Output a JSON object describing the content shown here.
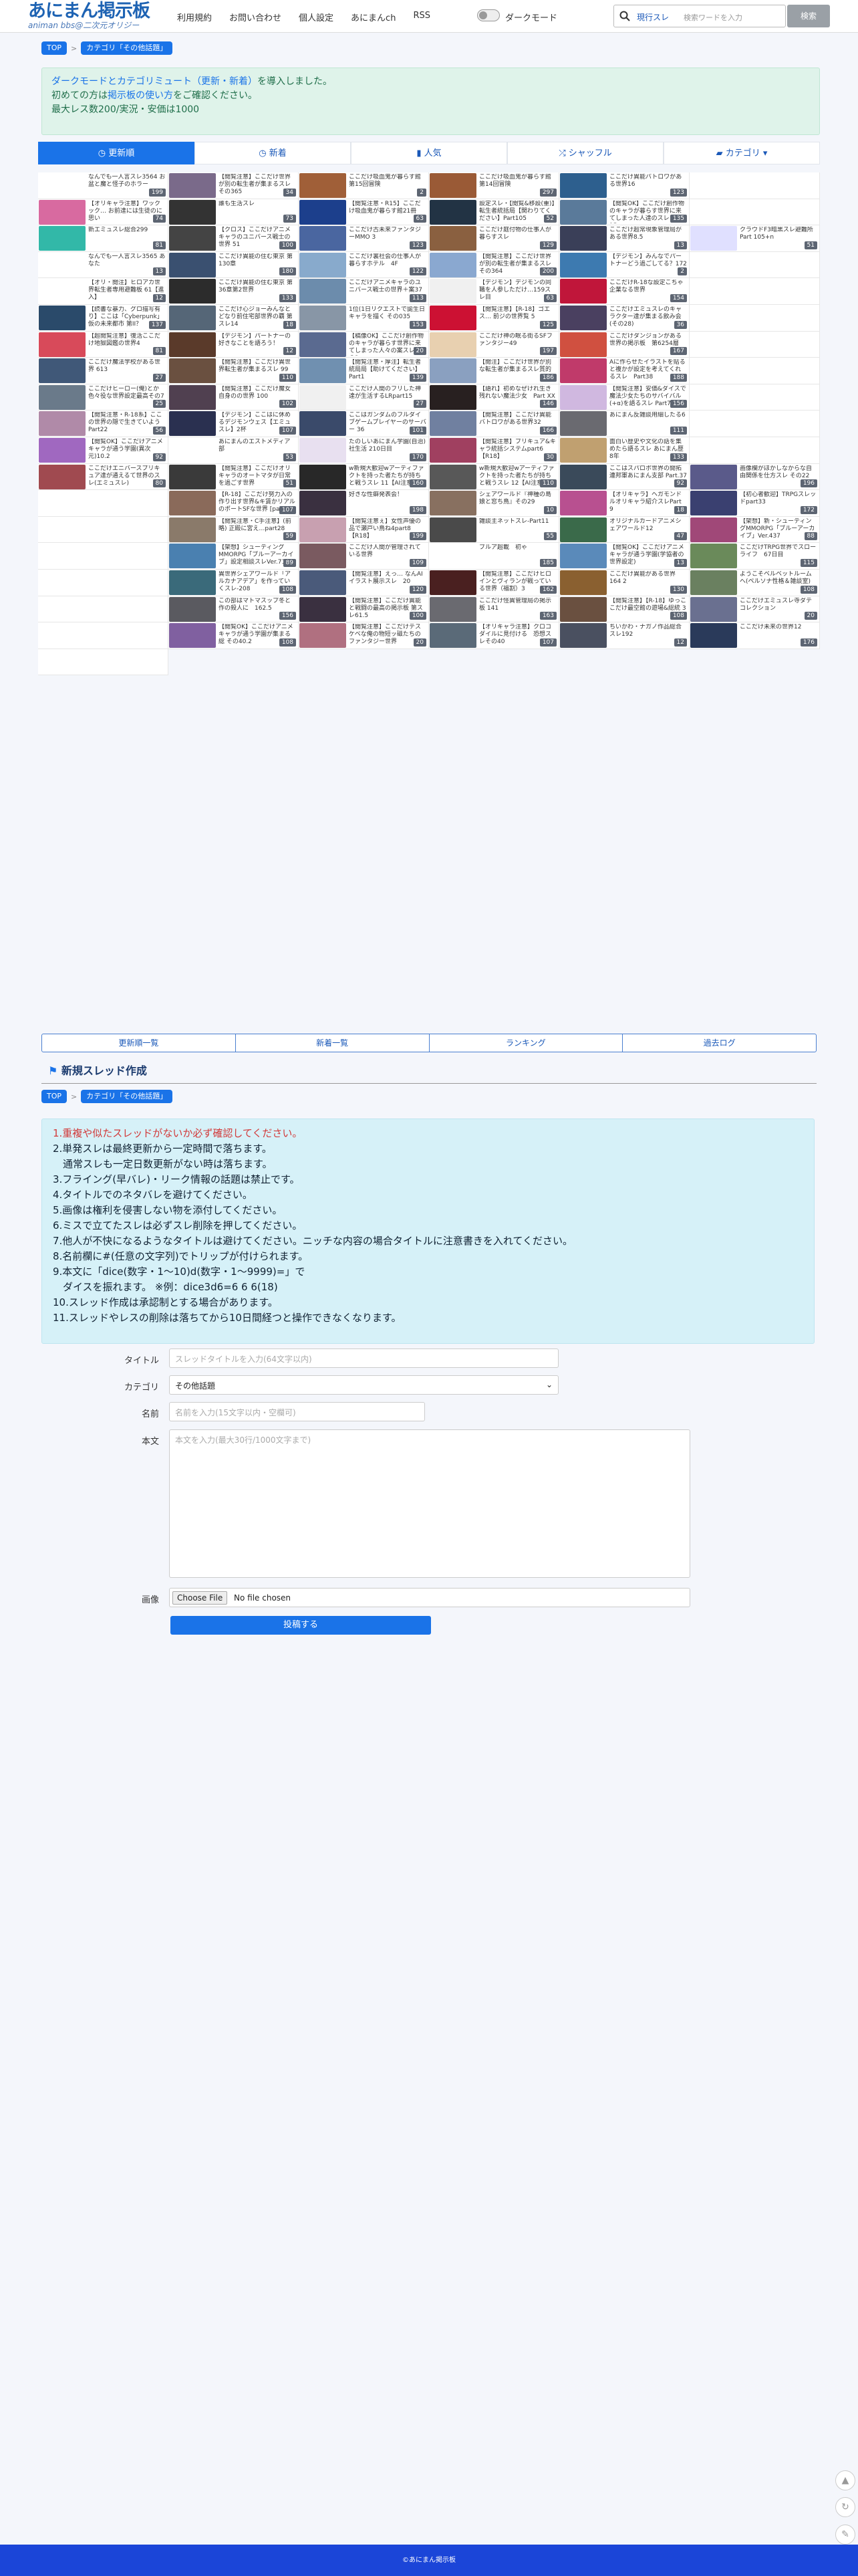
{
  "header": {
    "logo": "あにまん掲示板",
    "logo_sub": "animan bbs@二次元オリジー",
    "nav": [
      "利用規約",
      "お問い合わせ",
      "個人設定",
      "あにまんch",
      "RSS"
    ],
    "darkmode": "ダークモード",
    "search_select": "現行スレ",
    "search_placeholder": "検索ワードを入力",
    "search_button": "検索"
  },
  "breadcrumb": {
    "top": "TOP",
    "category": "カテゴリ「その他話題」"
  },
  "notice": {
    "line1_link": "ダークモードとカテゴリミュート（更新・新着）",
    "line1_rest": "を導入しました。",
    "line2_pre": "初めての方は",
    "line2_link": "掲示板の使い方",
    "line2_post": "をご確認ください。",
    "line3": "最大レス数200/実況・安価は1000"
  },
  "tabs": [
    "更新順",
    "新着",
    "人気",
    "シャッフル",
    "カテゴリ"
  ],
  "threads": [
    {
      "t": "なんでも一人言スレ3564 お盆と魔と怪子のホラー",
      "c": "199",
      "col": "#ffffff"
    },
    {
      "t": "【閲覧注意】ここだけ世界が別の転生者が集まるスレその365",
      "c": "34",
      "col": "#7a6a8a"
    },
    {
      "t": "ここだけ吸血鬼が暮らす館第15回冒険",
      "c": "2",
      "col": "#a05f38"
    },
    {
      "t": "ここだけ吸血鬼が暮らす館第14回冒険",
      "c": "297",
      "col": "#9a5a36"
    },
    {
      "t": "ここだけ異能バトロワがある世界16",
      "c": "123",
      "col": "#2d5f8e"
    },
    {
      "t": "",
      "c": "",
      "col": "#ffffff"
    },
    {
      "t": "【オリキャラ注意】ワックック… お前達には生徒のに思い",
      "c": "74",
      "col": "#d86aa0"
    },
    {
      "t": "誰も生活スレ",
      "c": "73",
      "col": "#333333"
    },
    {
      "t": "【閲覧注意・R15】ここだけ吸血鬼が暮らす館21冊",
      "c": "63",
      "col": "#1c3f8c"
    },
    {
      "t": "設定スレ・【閲覧&移設(重)】転生者統括局【関わりてください】Part105",
      "c": "52",
      "col": "#223344"
    },
    {
      "t": "【閲覧OK】ここだけ創作物のキャラが暮らす世界に来てしまった人達のスレ その15",
      "c": "135",
      "col": "#5a7a9a"
    },
    {
      "t": "",
      "c": "",
      "col": "#ffffff"
    },
    {
      "t": "新エミュスレ総合299",
      "c": "81",
      "col": "#32b8a8"
    },
    {
      "t": "【クロス】ここだけアニメキャラのユニバース戦士の世界 51",
      "c": "100",
      "col": "#444444"
    },
    {
      "t": "ここだけ古未来ファンタジーMMO 3",
      "c": "123",
      "col": "#4a66a0"
    },
    {
      "t": "ここだけ庭付物の仕事人が暮らすスレ",
      "c": "129",
      "col": "#8a6040"
    },
    {
      "t": "ここだけ超常現象管理局がある世界8.5",
      "c": "13",
      "col": "#3a3f58"
    },
    {
      "t": "クラウドF3暗黒スレ避難所Part 105+n",
      "c": "51",
      "col": "#e0e0ff"
    },
    {
      "t": "なんでも一人言スレ3565 あなた",
      "c": "13",
      "col": "#ffffff"
    },
    {
      "t": "ここだけ異能の住む東京 第130章",
      "c": "180",
      "col": "#3a5070"
    },
    {
      "t": "ここだけ裏社会の仕事人が暮らすホテル　4F",
      "c": "122",
      "col": "#88aacc"
    },
    {
      "t": "【閲覧注意】ここだけ世界が別の転生者が集まるスレその364",
      "c": "200",
      "col": "#8aa8d0"
    },
    {
      "t": "【デジモン】みんなでパートナーどう過ごしてる？172",
      "c": "2",
      "col": "#3d7ab0"
    },
    {
      "t": "",
      "c": "",
      "col": "#ffffff"
    },
    {
      "t": "【オリ・閲注】ヒロアカ世界転生者専用避難板 61【進入】",
      "c": "12",
      "col": "#ffffff"
    },
    {
      "t": "ここだけ異能の住む東京 第36章第2世界",
      "c": "133",
      "col": "#2c2c2c"
    },
    {
      "t": "ここだけアニメキャラのユニバース戦士の世界＋案37",
      "c": "113",
      "col": "#6c8cac"
    },
    {
      "t": "【デジモン】デジモンの同職を人参しただけ…159スレ目",
      "c": "63",
      "col": "#f0f0f0"
    },
    {
      "t": "ここだけR-18な設定こちゃ企業なる世界",
      "c": "154",
      "col": "#c0163a"
    },
    {
      "t": "",
      "c": "",
      "col": "#ffffff"
    },
    {
      "t": "【読書な暴力、グロ描写有り】ここは「Cyberpunk」仮の未来都市 第II？",
      "c": "137",
      "col": "#2a4a6a"
    },
    {
      "t": "ここだけ心ジョーみんなとどなり前住宅部世界の覇 第スレ14",
      "c": "18",
      "col": "#556677"
    },
    {
      "t": "1位(1日リクエストで誕生日キャラを描く その035",
      "c": "153",
      "col": "#8896a6"
    },
    {
      "t": "【閲覧注意】【R-18】ゴエス… 前ジの世界覧 5",
      "c": "125",
      "col": "#cc1133"
    },
    {
      "t": "ここだけエミュスレのキャラクター達が集まる飲み会(その28)",
      "c": "36",
      "col": "#4a4060"
    },
    {
      "t": "",
      "c": "",
      "col": "#ffffff"
    },
    {
      "t": "【超閲覧注意】復活ここだけ地獄図鑑の世界4",
      "c": "81",
      "col": "#d84a5a"
    },
    {
      "t": "【デジモン】パートナーの好きなことを語ろう！",
      "c": "12",
      "col": "#5a3a2a"
    },
    {
      "t": "【稿像OK】ここだけ創作物のキャラが暮らす世界に来てしまった人々の案スレ その3",
      "c": "20",
      "col": "#5a6a90"
    },
    {
      "t": "ここだけ神の眠る街るSFファンタジー49",
      "c": "197",
      "col": "#e8d0b0"
    },
    {
      "t": "ここだけダンジョンがある世界の掲示板　第6254層",
      "c": "167",
      "col": "#d05040"
    },
    {
      "t": "",
      "c": "",
      "col": "#ffffff"
    },
    {
      "t": "ここだけ魔法学校がある世界 613",
      "c": "27",
      "col": "#405878"
    },
    {
      "t": "【閲覧注意】ここだけ異世界転生者が集まるスレ 99",
      "c": "110",
      "col": "#6a5040"
    },
    {
      "t": "【閲覧注意・厚注】転生者統局局【助けてください】Part1",
      "c": "139",
      "col": "#7090b0"
    },
    {
      "t": "【閲注】ここだけ世界が別な転生者が集まるスレ質的",
      "c": "186",
      "col": "#8aa0c0"
    },
    {
      "t": "Aに作らせたイラストを貼ると複かが設定を考えてくれるスレ　Part38",
      "c": "188",
      "col": "#c03a6a"
    },
    {
      "t": "",
      "c": "",
      "col": "#ffffff"
    },
    {
      "t": "ここだけヒーロー(俺)とか色々役な世界設定最高その7",
      "c": "25",
      "col": "#6a7a8a"
    },
    {
      "t": "【閲覧注意】ここだけ魔女自身のの世界 100",
      "c": "102",
      "col": "#504050"
    },
    {
      "t": "ここだけ人間のフリした神達が生活するLRpart15",
      "c": "27",
      "col": "#f0f0f0"
    },
    {
      "t": "【語れ】初めなぜけれ生き残れない魔法少女　Part XX",
      "c": "146",
      "col": "#282020"
    },
    {
      "t": "【閲覧注意】安価&ダイスで魔法少女たちのサバイバル(+α)を語るスレ Part7",
      "c": "156",
      "col": "#d0b8e0"
    },
    {
      "t": "",
      "c": "",
      "col": "#ffffff"
    },
    {
      "t": "【閲覧注意・R-18系】ここの世界の隠で生きていようPart22",
      "c": "56",
      "col": "#b08aa8"
    },
    {
      "t": "【デジモン】ここはに休めるデジモンウェス【エミュスレ】2杯",
      "c": "107",
      "col": "#2a3050"
    },
    {
      "t": "ここはガンダムのフルダイブゲームプレイヤーのサーバー 36",
      "c": "101",
      "col": "#3a4a6a"
    },
    {
      "t": "【閲覧注意】ここだけ異能バトロワがある世界32",
      "c": "166",
      "col": "#7080a0"
    },
    {
      "t": "あにまん反雑談用細したる6",
      "c": "111",
      "col": "#6a6a70"
    },
    {
      "t": "",
      "c": "",
      "col": "#ffffff"
    },
    {
      "t": "【閲覧OK】ここだけアニメキャラが通う学園(異次元)10.2",
      "c": "92",
      "col": "#a068c0"
    },
    {
      "t": "あにまんのエストメディア部",
      "c": "53",
      "col": "#ffffff"
    },
    {
      "t": "たのしいあにまん学園(自治)社生活 210日目",
      "c": "170",
      "col": "#e8e0f0"
    },
    {
      "t": "【閲覧注意】ブリキュア&キャラ統括システムpart6【R18】",
      "c": "30",
      "col": "#a04060"
    },
    {
      "t": "面白い歴史や文化の話を集めたら語るスレ あにまん歴8年",
      "c": "133",
      "col": "#c0a070"
    },
    {
      "t": "",
      "c": "",
      "col": "#ffffff"
    },
    {
      "t": "ここだけエニバースプリキュア達が通えるて世界のスレ(エミュスレ)",
      "c": "80",
      "col": "#a04a50"
    },
    {
      "t": "【閲覧注意】ここだけオリキャラのオートマタが日常を過ごす世界",
      "c": "51",
      "col": "#3a3a3a"
    },
    {
      "t": "w新規大歓迎wアーティファクトを持った者たちが持ちと戦うスレ 11【AI注意】",
      "c": "160",
      "col": "#282828"
    },
    {
      "t": "w新規大歓迎wアーティファクトを持った者たちが持ちと戦うスレ 12【AI注意】",
      "c": "110",
      "col": "#585858"
    },
    {
      "t": "ここはスパロボ世界の開拓連邦軍あにまん支部 Part.37",
      "c": "92",
      "col": "#3a4a5a"
    },
    {
      "t": "画像欄がほかしなからな自由関係を仕方スレ その22",
      "c": "196",
      "col": "#5a5a8a"
    },
    {
      "t": "",
      "c": "",
      "col": "#ffffff"
    },
    {
      "t": "【R-18】ここだけ努力入の作り出す世界&キ賃かリアルのポートSFな世界 [part34]",
      "c": "107",
      "col": "#8a6a5a"
    },
    {
      "t": "好きな性癖発表会！",
      "c": "198",
      "col": "#3a3040"
    },
    {
      "t": "シェアワールド『神種の島娘と窓ち鳥』その29",
      "c": "10",
      "col": "#887060"
    },
    {
      "t": "【オリキャラ】ヘガモンドルオリキャラ紹介スレPart 9",
      "c": "18",
      "col": "#b85090"
    },
    {
      "t": "【初心者歓迎】TRPGスレッドpart33",
      "c": "172",
      "col": "#3a4070"
    },
    {
      "t": "",
      "c": "",
      "col": "#ffffff"
    },
    {
      "t": "【閲覧注意・C手注意】(前略) 正殿に宮え…part28",
      "c": "59",
      "col": "#8a7a6a"
    },
    {
      "t": "【閲覧注意ぇ】女性声優の品で瀬戸い鳥ね4part8【R18】",
      "c": "199",
      "col": "#c8a0b0"
    },
    {
      "t": "雑談主ネットスレ-Part11",
      "c": "55",
      "col": "#4a4a4a"
    },
    {
      "t": "オリジナルカードアニメシェアワールド12",
      "c": "47",
      "col": "#3a6a4a"
    },
    {
      "t": "【架想】新・シューティングMMORPG「ブルーアーカイブ」Ver.437",
      "c": "88",
      "col": "#a04878"
    },
    {
      "t": "",
      "c": "",
      "col": "#ffffff"
    },
    {
      "t": "【架想】シューティングMMORPG「ブルーアーカイブ」設定相談スレVer.71.5",
      "c": "89",
      "col": "#4a80b0"
    },
    {
      "t": "ここだけ人間が管理されている世界",
      "c": "109",
      "col": "#7a5a60"
    },
    {
      "t": "ブルア超載　初ゃ",
      "c": "185",
      "col": "#ffffff"
    },
    {
      "t": "【閲覧OK】ここだけアニメキャラが通う学園(学協者の世界設定)",
      "c": "13",
      "col": "#5a8aba"
    },
    {
      "t": "ここだけTRPG世界でスローライフ　67日目",
      "c": "115",
      "col": "#6a8a5a"
    },
    {
      "t": "",
      "c": "",
      "col": "#ffffff"
    },
    {
      "t": "異世界シェアワールド「ア ルカナアデア」を作っていくスレ-208",
      "c": "108",
      "col": "#3a6a7a"
    },
    {
      "t": "【閲覧注意】えっ… なんAI イラスト展示スレ　20",
      "c": "120",
      "col": "#4a5a7a"
    },
    {
      "t": "【閲覧注意】ここだけヒロインとヴィランが戦っている世界（福割）3",
      "c": "162",
      "col": "#4a2020"
    },
    {
      "t": "ここだけ異能がある世界164 2",
      "c": "130",
      "col": "#8a6030"
    },
    {
      "t": "ようこそベルベットルームへ(ペルソナ性格＆雑談室)",
      "c": "108",
      "col": "#6a8060"
    },
    {
      "t": "",
      "c": "",
      "col": "#ffffff"
    },
    {
      "t": "この部はマトマスップ冬と作の殺人に　162.5",
      "c": "156",
      "col": "#5a5a60"
    },
    {
      "t": "【閲覧注意】ここだけ異能と戦闘の最高の掲示板 第スレ61.5",
      "c": "100",
      "col": "#3a3040"
    },
    {
      "t": "ここだけ怪異管理局の掲示板 141",
      "c": "163",
      "col": "#6a6a70"
    },
    {
      "t": "【閲覧注意】【R-18】ゆっここだけ最空館の遊場&総統 3",
      "c": "108",
      "col": "#6a5040"
    },
    {
      "t": "ここだけエミュスレ寺ダテコレクション",
      "c": "20",
      "col": "#6a7090"
    },
    {
      "t": "",
      "c": "",
      "col": "#ffffff"
    },
    {
      "t": "【閲覧OK】ここだけアニメキャラが通う学園が集まる 総 その40.2",
      "c": "108",
      "col": "#8060a0"
    },
    {
      "t": "【閲覧注意】ここだけテスケベな俺の物短ッ磁たちのファンタジー世界",
      "c": "20",
      "col": "#b07080"
    },
    {
      "t": "【オリキャラ注意】クロコダイルに見付ける　恐想スレその40",
      "c": "107",
      "col": "#5a6a78"
    },
    {
      "t": "ちいかわ・ナガノ作品総合スレ192",
      "c": "12",
      "col": "#4a5060"
    },
    {
      "t": "ここだけ未来の世界12",
      "c": "176",
      "col": "#2a3a5a"
    },
    {
      "t": "",
      "c": "",
      "col": "#ffffff"
    }
  ],
  "bottom_links": [
    "更新順一覧",
    "新着一覧",
    "ランキング",
    "過去ログ"
  ],
  "new_thread": {
    "title": "新規スレッド作成"
  },
  "rules": [
    "1.重複や似たスレッドがないか必ず確認してください。",
    "2.単発スレは最終更新から一定時間で落ちます。",
    "　通常スレも一定日数更新がない時は落ちます。",
    "3.フライング(早バレ)・リーク情報の話題は禁止です。",
    "4.タイトルでのネタバレを避けてください。",
    "5.画像は権利を侵害しない物を添付してください。",
    "6.ミスで立てたスレは必ずスレ削除を押してください。",
    "7.他人が不快になるようなタイトルは避けてください。ニッチな内容の場合タイトルに注意書きを入れてください。",
    "8.名前欄に#(任意の文字列)でトリップが付けられます。",
    "9.本文に「dice(数字・1〜10)d(数字・1〜9999)=」で",
    "　ダイスを振れます。 ※例：dice3d6=6 6 6(18)",
    "10.スレッド作成は承認制とする場合があります。",
    "11.スレッドやレスの削除は落ちてから10日間経つと操作できなくなります。"
  ],
  "form": {
    "title_label": "タイトル",
    "title_placeholder": "スレッドタイトルを入力(64文字以内)",
    "category_label": "カテゴリ",
    "category_value": "その他話題",
    "name_label": "名前",
    "name_placeholder": "名前を入力(15文字以内・空欄可)",
    "body_label": "本文",
    "body_placeholder": "本文を入力(最大30行/1000文字まで)",
    "image_label": "画像",
    "file_button": "Choose File",
    "file_status": "No file chosen",
    "submit": "投稿する"
  },
  "footer": "©あにまん掲示板",
  "colors": {
    "accent": "#1a73e8",
    "footer": "#1b45d8",
    "notice_bg": "#dff3ea",
    "rules_bg": "#d6f1f8"
  }
}
